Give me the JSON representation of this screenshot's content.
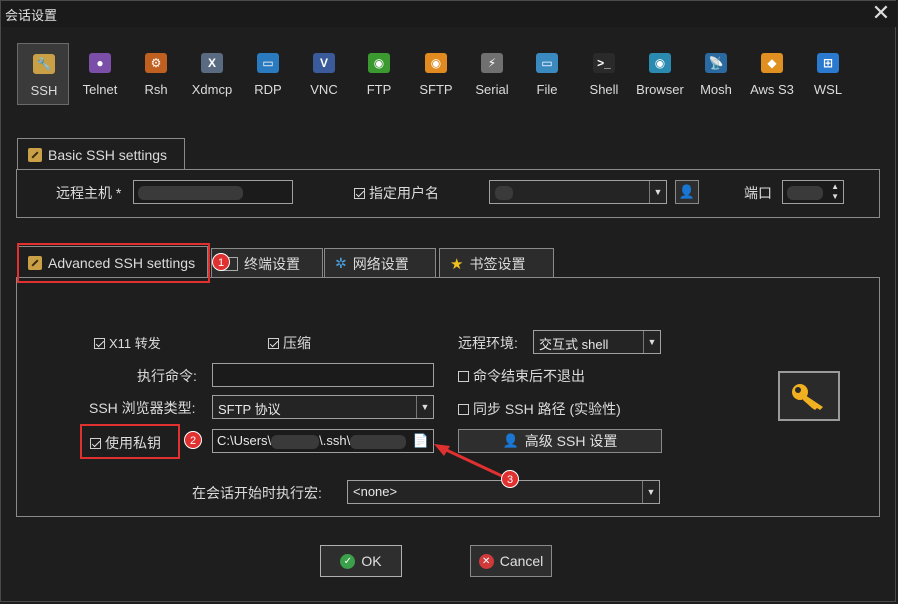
{
  "window": {
    "title": "会话设置",
    "close": "✕"
  },
  "protocols": [
    {
      "label": "SSH",
      "icon": "wrench-icon",
      "color": "#c9a045",
      "glyph": "🔧"
    },
    {
      "label": "Telnet",
      "icon": "purple-orb-icon",
      "color": "#7b4fa8",
      "glyph": "●"
    },
    {
      "label": "Rsh",
      "icon": "rsh-icon",
      "color": "#c06020",
      "glyph": "⚙"
    },
    {
      "label": "Xdmcp",
      "icon": "x-window-icon",
      "color": "#5a6a80",
      "glyph": "X"
    },
    {
      "label": "RDP",
      "icon": "monitor-icon",
      "color": "#2a7ac0",
      "glyph": "▭"
    },
    {
      "label": "VNC",
      "icon": "vnc-icon",
      "color": "#3a5a9a",
      "glyph": "V"
    },
    {
      "label": "FTP",
      "icon": "globe-green-icon",
      "color": "#3a9a30",
      "glyph": "◉"
    },
    {
      "label": "SFTP",
      "icon": "globe-orange-icon",
      "color": "#e08a20",
      "glyph": "◉"
    },
    {
      "label": "Serial",
      "icon": "serial-plug-icon",
      "color": "#707070",
      "glyph": "⚡"
    },
    {
      "label": "File",
      "icon": "file-monitor-icon",
      "color": "#3a8ac0",
      "glyph": "▭"
    },
    {
      "label": "Shell",
      "icon": "terminal-icon",
      "color": "#2a2a2a",
      "glyph": ">_"
    },
    {
      "label": "Browser",
      "icon": "browser-globe-icon",
      "color": "#2a8ab0",
      "glyph": "◉"
    },
    {
      "label": "Mosh",
      "icon": "satellite-icon",
      "color": "#2a6aa0",
      "glyph": "📡"
    },
    {
      "label": "Aws S3",
      "icon": "aws-cubes-icon",
      "color": "#e09020",
      "glyph": "◆"
    },
    {
      "label": "WSL",
      "icon": "windows-icon",
      "color": "#2a7ad0",
      "glyph": "⊞"
    }
  ],
  "basic": {
    "tab_label": "Basic SSH settings",
    "remote_host_label": "远程主机 *",
    "specify_user_label": "指定用户名",
    "port_label": "端口"
  },
  "tabs": {
    "advanced": "Advanced SSH settings",
    "terminal": "终端设置",
    "network": "网络设置",
    "bookmark": "书签设置"
  },
  "advanced": {
    "x11_label": "X11 转发",
    "compress_label": "压缩",
    "remote_env_label": "远程环境:",
    "remote_env_value": "交互式 shell",
    "exec_cmd_label": "执行命令:",
    "no_exit_label": "命令结束后不退出",
    "browser_type_label": "SSH 浏览器类型:",
    "browser_type_value": "SFTP 协议",
    "sync_path_label": "同步 SSH 路径 (实验性)",
    "use_key_label": "使用私钥",
    "key_path_prefix": "C:\\Users\\",
    "key_path_mid": "\\.ssh\\",
    "expert_button": "高级 SSH 设置",
    "macro_label": "在会话开始时执行宏:",
    "macro_value": "<none>"
  },
  "annotations": [
    "1",
    "2",
    "3"
  ],
  "buttons": {
    "ok": "OK",
    "cancel": "Cancel"
  }
}
